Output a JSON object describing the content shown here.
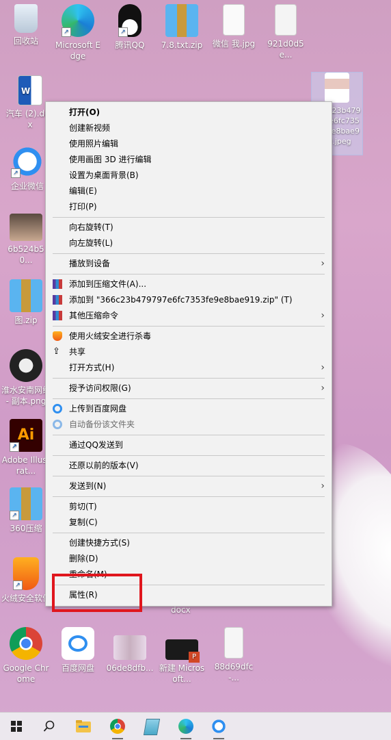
{
  "desktop": {
    "icons": [
      {
        "label": "回收站"
      },
      {
        "label": "Microsoft Edge"
      },
      {
        "label": "腾讯QQ"
      },
      {
        "label": "7.8.txt.zip"
      },
      {
        "label": "微信 我.jpg"
      },
      {
        "label": "921d0d5e..."
      },
      {
        "label": "汽车 (2).docx"
      },
      {
        "label": "企业微信"
      },
      {
        "label": "6b524b50..."
      },
      {
        "label": "图.zip"
      },
      {
        "label": "淮水安南网络 - 副本.png"
      },
      {
        "label": "Adobe Illustrat..."
      },
      {
        "label": "360压缩"
      },
      {
        "label": "火绒安全软件"
      },
      {
        "label": "Google Chrome"
      },
      {
        "label": "百度网盘"
      },
      {
        "label": "06de8dfb..."
      },
      {
        "label": "新建 Microsoft..."
      },
      {
        "label": "88d69dfc-..."
      },
      {
        "label": "366c23b479 797e6fc735 3fe9e8bae9 19.jpeg"
      },
      {
        "label": "docx"
      }
    ]
  },
  "context_menu": {
    "items": [
      {
        "label": "打开(O)"
      },
      {
        "label": "创建新视频"
      },
      {
        "label": "使用照片编辑"
      },
      {
        "label": "使用画图 3D 进行编辑"
      },
      {
        "label": "设置为桌面背景(B)"
      },
      {
        "label": "编辑(E)"
      },
      {
        "label": "打印(P)"
      },
      {
        "label": "向右旋转(T)"
      },
      {
        "label": "向左旋转(L)"
      },
      {
        "label": "播放到设备"
      },
      {
        "label": "添加到压缩文件(A)..."
      },
      {
        "label": "添加到 \"366c23b479797e6fc7353fe9e8bae919.zip\" (T)"
      },
      {
        "label": "其他压缩命令"
      },
      {
        "label": "使用火绒安全进行杀毒"
      },
      {
        "label": "共享"
      },
      {
        "label": "打开方式(H)"
      },
      {
        "label": "授予访问权限(G)"
      },
      {
        "label": "上传到百度网盘"
      },
      {
        "label": "自动备份该文件夹"
      },
      {
        "label": "通过QQ发送到"
      },
      {
        "label": "还原以前的版本(V)"
      },
      {
        "label": "发送到(N)"
      },
      {
        "label": "剪切(T)"
      },
      {
        "label": "复制(C)"
      },
      {
        "label": "创建快捷方式(S)"
      },
      {
        "label": "删除(D)"
      },
      {
        "label": "重命名(M)"
      },
      {
        "label": "属性(R)"
      }
    ],
    "submenu_arrow": "›"
  },
  "taskbar": {
    "icons": [
      "windows-start-icon",
      "search-icon",
      "file-explorer-icon",
      "chrome-icon",
      "notepad-icon",
      "edge-icon",
      "wecom-icon"
    ]
  },
  "colors": {
    "highlight_box": "#e0161d",
    "menu_bg": "#f2f2f2"
  }
}
